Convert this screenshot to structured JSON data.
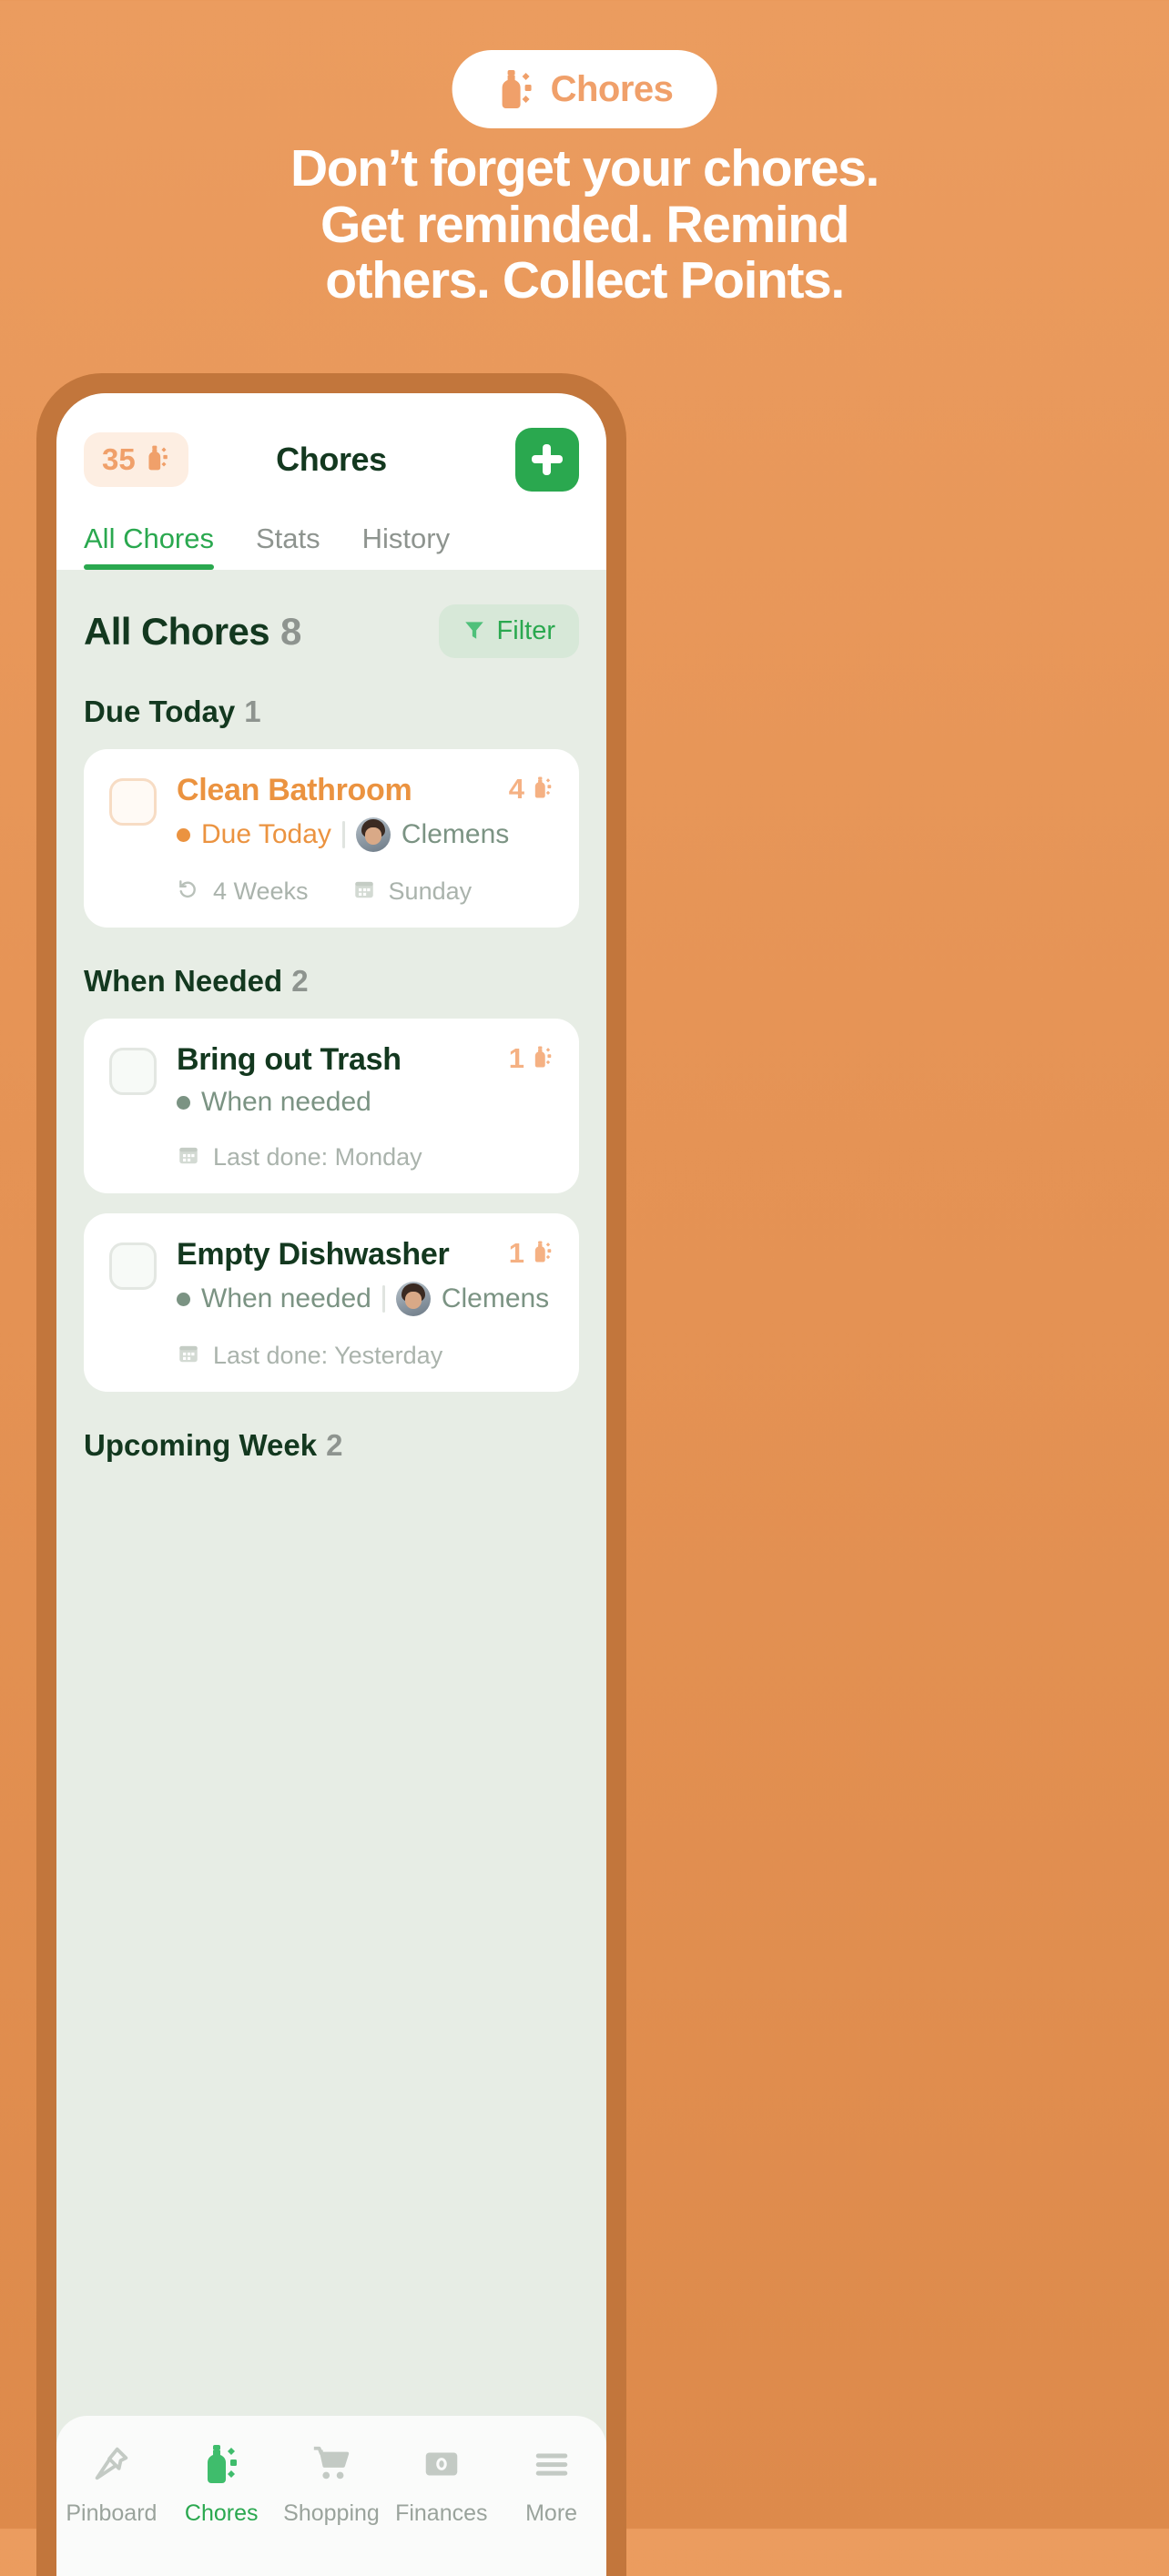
{
  "promo": {
    "badge_label": "Chores",
    "badge_icon": "spray-bottle-icon",
    "headline_lines": [
      "Don’t forget your chores.",
      "Get reminded. Remind",
      "others. Collect Points."
    ]
  },
  "colors": {
    "background_orange": "#e59355",
    "phone_bezel": "#c2763c",
    "accent_green": "#2aa84f",
    "dark_green": "#13381f",
    "accent_orange": "#eb9340",
    "points_orange": "#f0a06a",
    "muted_gray": "#8e948f",
    "screen_bg": "#e7ede5"
  },
  "app": {
    "points_badge": {
      "value": "35",
      "icon": "spray-bottle-icon"
    },
    "title": "Chores",
    "add_button": {
      "icon": "plus-icon",
      "label": "+"
    },
    "tabs": [
      {
        "label": "All Chores",
        "active": true
      },
      {
        "label": "Stats",
        "active": false
      },
      {
        "label": "History",
        "active": false
      }
    ]
  },
  "list": {
    "section_title": "All Chores",
    "section_count": "8",
    "filter_button": {
      "label": "Filter",
      "icon": "funnel-icon"
    },
    "groups": [
      {
        "title": "Due Today",
        "count": "1",
        "items": [
          {
            "name": "Clean Bathroom",
            "name_color": "orange",
            "status": "Due Today",
            "status_color": "orange",
            "assignee": "Clemens",
            "has_assignee": true,
            "points": "4",
            "repeat": "4 Weeks",
            "repeat_icon": "repeat-icon",
            "date": "Sunday",
            "date_icon": "calendar-icon",
            "has_repeat": true
          }
        ]
      },
      {
        "title": "When Needed",
        "count": "2",
        "items": [
          {
            "name": "Bring out Trash",
            "name_color": "green",
            "status": "When needed",
            "status_color": "gray",
            "assignee": "",
            "has_assignee": false,
            "points": "1",
            "repeat": "",
            "date": "Last done: Monday",
            "date_icon": "calendar-icon",
            "has_repeat": false
          },
          {
            "name": "Empty Dishwasher",
            "name_color": "green",
            "status": "When needed",
            "status_color": "gray",
            "assignee": "Clemens",
            "has_assignee": true,
            "points": "1",
            "repeat": "",
            "date": "Last done: Yesterday",
            "date_icon": "calendar-icon",
            "has_repeat": false
          }
        ]
      },
      {
        "title": "Upcoming Week",
        "count": "2",
        "items": []
      }
    ]
  },
  "bottom_nav": [
    {
      "label": "Pinboard",
      "icon": "pin-icon",
      "active": false
    },
    {
      "label": "Chores",
      "icon": "spray-bottle-icon",
      "active": true
    },
    {
      "label": "Shopping",
      "icon": "shopping-cart-icon",
      "active": false
    },
    {
      "label": "Finances",
      "icon": "banknote-icon",
      "active": false
    },
    {
      "label": "More",
      "icon": "hamburger-menu-icon",
      "active": false
    }
  ]
}
